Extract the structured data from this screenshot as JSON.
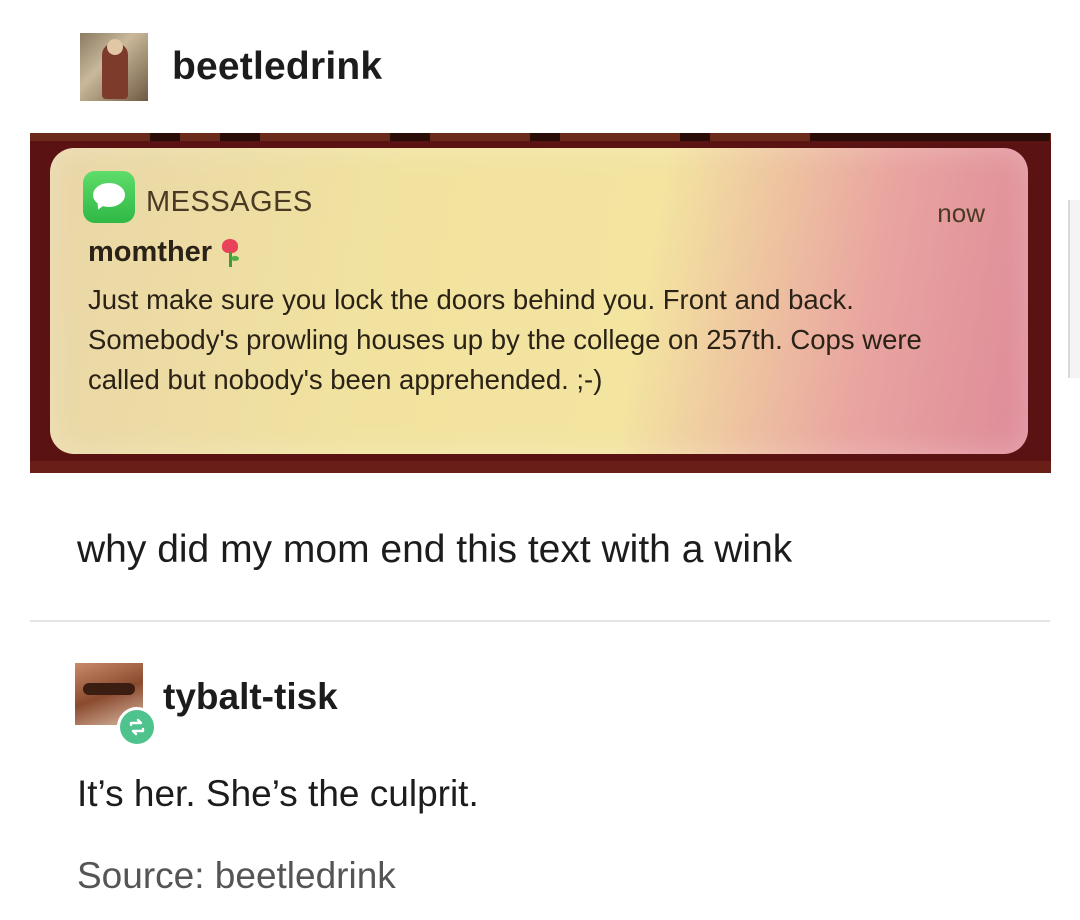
{
  "post": {
    "username": "beetledrink",
    "avatar_icon": "user-avatar"
  },
  "notification": {
    "app_name": "MESSAGES",
    "app_icon": "messages-app-icon",
    "time": "now",
    "sender": "momther",
    "sender_emoji": "rose-icon",
    "body": "Just make sure you lock the doors behind you. Front and back. Somebody's prowling houses up by the college on 257th. Cops were called but nobody's been apprehended. ;-)",
    "colors": {
      "gradient_left": "#f1e39f",
      "gradient_right": "#de8a98",
      "frame": "#5a1212",
      "icon_green": "#2fb845"
    }
  },
  "caption": "why did my mom end this text with a wink",
  "reblog": {
    "username": "tybalt-tisk",
    "icon": "reblog-icon",
    "reply": "It’s her. She’s the culprit."
  },
  "source": "Source: beetledrink"
}
